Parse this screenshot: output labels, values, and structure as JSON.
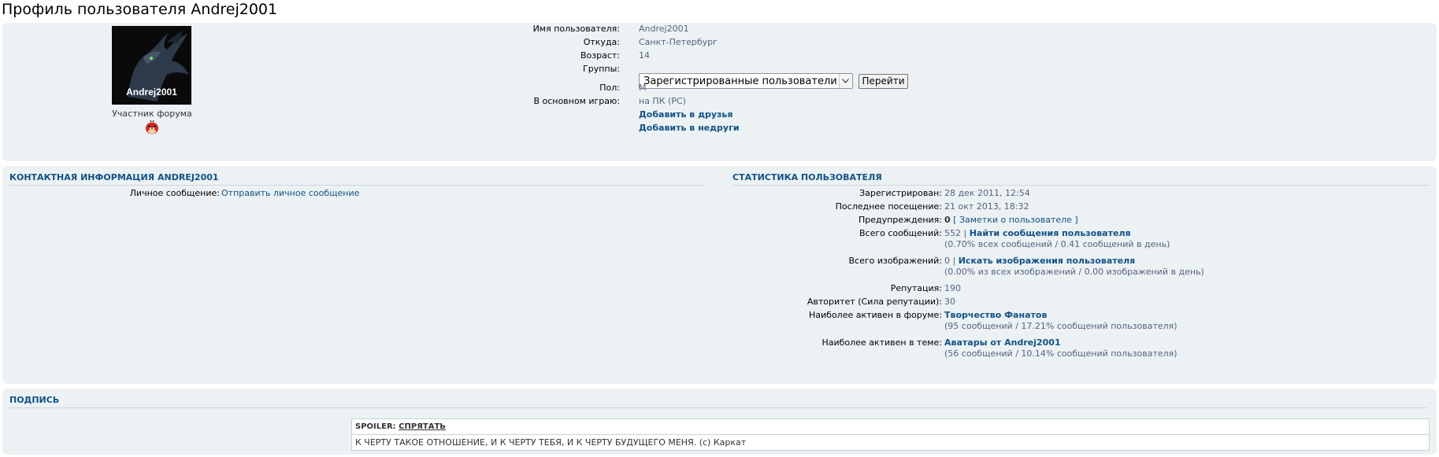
{
  "page": {
    "title": "Профиль пользователя Andrej2001"
  },
  "profile": {
    "avatar_caption": "Andrej2001",
    "rank": "Участник форума",
    "rank_icon": "angry-bird-icon",
    "fields": {
      "username_label": "Имя пользователя:",
      "username": "Andrej2001",
      "location_label": "Откуда:",
      "location": "Санкт-Петербург",
      "age_label": "Возраст:",
      "age": "14",
      "groups_label": "Группы:",
      "groups_selected": "Зарегистрированные пользователи",
      "go_button": "Перейти",
      "gender_label": "Пол:",
      "gender": "М",
      "platform_label": "В основном играю:",
      "platform": "на ПК (PC)"
    },
    "add_friend": "Добавить в друзья",
    "add_foe": "Добавить в недруги"
  },
  "contact": {
    "heading": "КОНТАКТНАЯ ИНФОРМАЦИЯ ANDREJ2001",
    "pm_label": "Личное сообщение:",
    "pm_link": "Отправить личное сообщение"
  },
  "stats": {
    "heading": "СТАТИСТИКА ПОЛЬЗОВАТЕЛЯ",
    "registered_label": "Зарегистрирован:",
    "registered": "28 дек 2011, 12:54",
    "last_visit_label": "Последнее посещение:",
    "last_visit": "21 окт 2013, 18:32",
    "warnings_label": "Предупреждения:",
    "warnings": "0",
    "notes_link": "[ Заметки о пользователе ]",
    "posts_label": "Всего сообщений:",
    "posts": "552",
    "posts_sep": "|",
    "posts_link": "Найти сообщения пользователя",
    "posts_sub": "(0.70% всех сообщений / 0.41 сообщений в день)",
    "images_label": "Всего изображений:",
    "images": "0",
    "images_sep": "|",
    "images_link": "Искать изображения пользователя",
    "images_sub": "(0.00% из всех изображений / 0.00 изображений в день)",
    "reputation_label": "Репутация:",
    "reputation": "190",
    "authority_label": "Авторитет (Сила репутации):",
    "authority": "30",
    "active_forum_label": "Наиболее активен в форуме:",
    "active_forum": "Творчество Фанатов",
    "active_forum_sub": "(95 сообщений / 17.21% сообщений пользователя)",
    "active_topic_label": "Наиболее активен в теме:",
    "active_topic": "Аватары от Andrej2001",
    "active_topic_sub": "(56 сообщений / 10.14% сообщений пользователя)"
  },
  "signature": {
    "heading": "ПОДПИСЬ",
    "spoiler_label": "SPOILER:",
    "spoiler_toggle": "СПРЯТАТЬ",
    "text": "К ЧЕРТУ ТАКОЕ ОТНОШЕНИЕ, И К ЧЕРТУ ТЕБЯ, И К ЧЕРТУ БУДУЩЕГО МЕНЯ. (с) Каркат"
  },
  "colors": {
    "panel_bg": "#ecf1f3",
    "link": "#105289",
    "value": "#536482"
  }
}
